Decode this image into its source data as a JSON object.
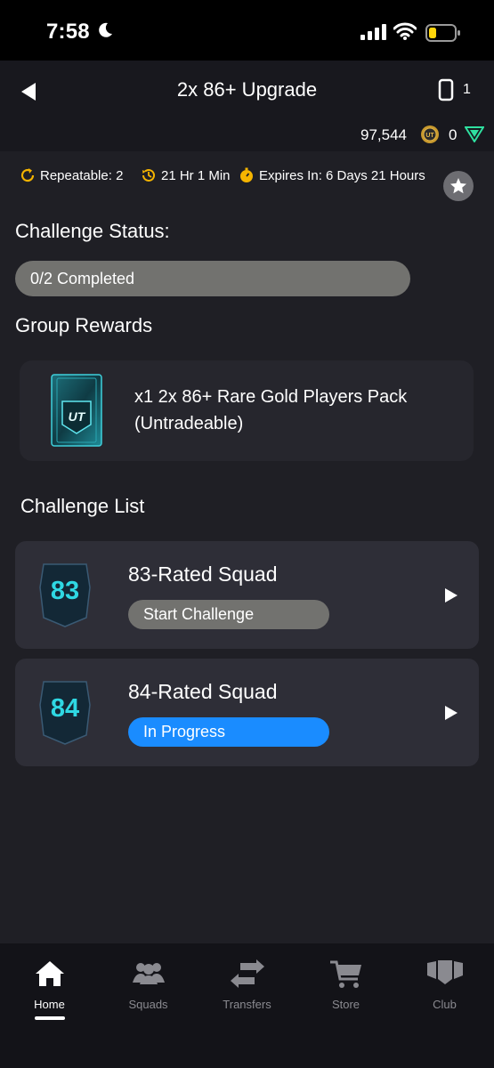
{
  "status_bar": {
    "time": "7:58"
  },
  "header": {
    "title": "2x 86+ Upgrade",
    "pack_count": "1",
    "coins": "97,544",
    "points": "0"
  },
  "info": {
    "repeatable": "Repeatable: 2",
    "refresh": "21 Hr 1 Min",
    "expires": "Expires In: 6 Days 21 Hours"
  },
  "challenge_status": {
    "heading": "Challenge Status:",
    "progress": "0/2 Completed"
  },
  "group_rewards": {
    "heading": "Group Rewards",
    "reward_text": "x1 2x 86+ Rare Gold Players Pack (Untradeable)",
    "pack_logo": "UT"
  },
  "challenge_list": {
    "heading": "Challenge List",
    "items": [
      {
        "rating": "83",
        "title": "83-Rated Squad",
        "status": "Start Challenge",
        "status_color": "#72726f"
      },
      {
        "rating": "84",
        "title": "84-Rated Squad",
        "status": "In Progress",
        "status_color": "#1a8cff"
      }
    ]
  },
  "tabbar": {
    "tabs": [
      {
        "label": "Home",
        "icon": "home-icon",
        "active": true
      },
      {
        "label": "Squads",
        "icon": "squads-icon",
        "active": false
      },
      {
        "label": "Transfers",
        "icon": "transfers-icon",
        "active": false
      },
      {
        "label": "Store",
        "icon": "cart-icon",
        "active": false
      },
      {
        "label": "Club",
        "icon": "club-icon",
        "active": false
      }
    ]
  },
  "colors": {
    "accent_gold": "#f5b400",
    "progress_blue": "#1a8cff",
    "rating_cyan": "#2fd8e3"
  }
}
